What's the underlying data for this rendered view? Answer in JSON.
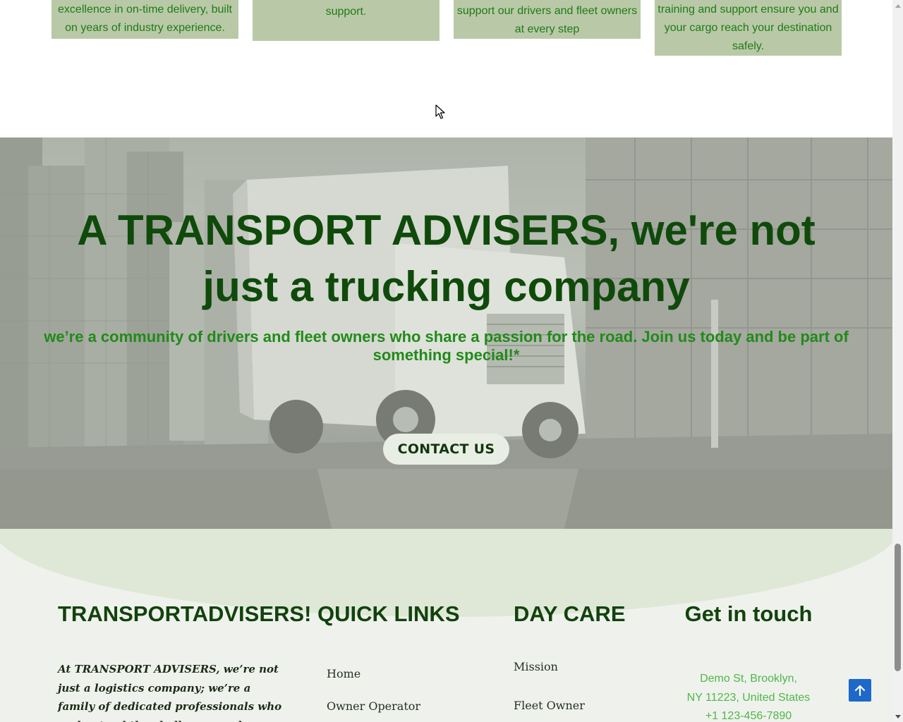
{
  "features": {
    "cards": [
      {
        "text": "excellence in on-time delivery, built on years of industry experience."
      },
      {
        "text": "support."
      },
      {
        "text": "support our drivers and fleet owners at every step"
      },
      {
        "text": "training and support ensure you and your cargo reach your destination safely."
      }
    ],
    "card_color": "#b9c9a7",
    "text_color": "#1f7a17"
  },
  "hero": {
    "title": "A TRANSPORT ADVISERS, we're not just a trucking company",
    "subtitle": "we’re a community of drivers and fleet owners who share a passion for the road. Join us today and be part of something special!*",
    "cta_label": "CONTACT US",
    "title_color": "#0f4a0b",
    "subtitle_color": "#228a1a"
  },
  "footer": {
    "brand": {
      "title": "TRANSPORTADVISERS!",
      "about": "At TRANSPORT ADVISERS, we’re not just a logistics company; we’re a family of dedicated professionals who understand the challenges and rewards of life on the"
    },
    "quick_links": {
      "title": "QUICK LINKS",
      "items": [
        "Home",
        "Owner Operator"
      ]
    },
    "day_care": {
      "title": "DAY CARE",
      "items": [
        "Mission",
        "Fleet Owner"
      ]
    },
    "contact": {
      "title": "Get in touch",
      "address_line1": "Demo St, Brooklyn,",
      "address_line2": "NY 11223, United States",
      "phone": "+1 123-456-7890"
    },
    "heading_color": "#12420d",
    "contact_color": "#4fb64a"
  },
  "icons": {
    "scroll_top": "arrow-up-icon",
    "cursor": "mouse-pointer-icon"
  },
  "accent_color": "#1d68c8"
}
